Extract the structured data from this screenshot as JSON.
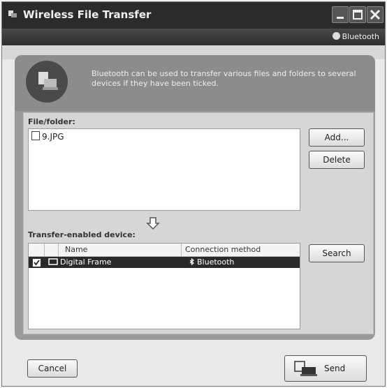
{
  "window": {
    "title": "Wireless File Transfer",
    "brand": "Bluetooth"
  },
  "header": {
    "description": "Bluetooth can be used to transfer various files and folders to several devices if they have been ticked."
  },
  "files": {
    "label": "File/folder:",
    "items": [
      "9.JPG"
    ],
    "add_label": "Add...",
    "delete_label": "Delete"
  },
  "devices": {
    "label": "Transfer-enabled device:",
    "columns": [
      "Name",
      "Connection method"
    ],
    "rows": [
      {
        "checked": true,
        "name": "Digital Frame",
        "connection": "Bluetooth"
      }
    ],
    "search_label": "Search"
  },
  "footer": {
    "cancel_label": "Cancel",
    "send_label": "Send"
  },
  "icons": [
    "app-icon",
    "minimize-icon",
    "maximize-icon",
    "close-icon",
    "bluetooth-icon",
    "transfer-icon",
    "file-icon",
    "down-arrow-icon",
    "device-icon",
    "send-icon"
  ]
}
